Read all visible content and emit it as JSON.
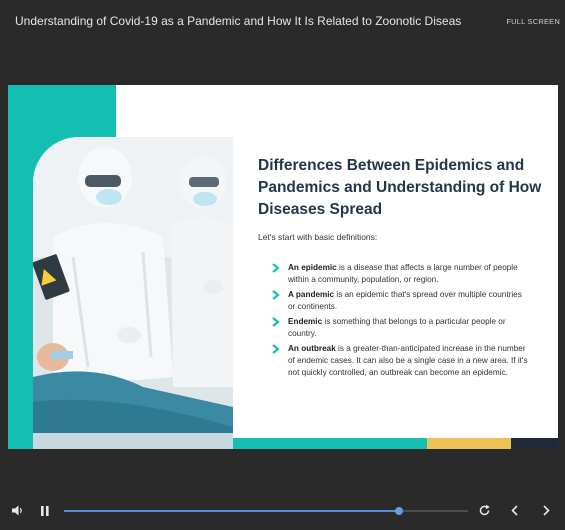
{
  "header": {
    "title": "Understanding of Covid-19 as a Pandemic and How It Is Related to Zoonotic Diseas",
    "fullscreen_label": "FULL SCREEN"
  },
  "slide": {
    "heading": "Differences Between Epidemics and Pandemics and Understanding of How Diseases Spread",
    "intro": "Let's start with basic definitions:",
    "bullets": [
      {
        "term": "An epidemic",
        "text": " is a disease that affects a large number of people within a community, population, or region."
      },
      {
        "term": "A pandemic",
        "text": " is an epidemic that's spread over multiple countries or continents."
      },
      {
        "term": "Endemic",
        "text": " is something that belongs to a particular people or country."
      },
      {
        "term": "An outbreak",
        "text": " is a greater-than-anticipated increase in the number of endemic cases. It can also be a single case in a new area. If it's not quickly controlled, an outbreak can become an epidemic."
      }
    ],
    "colors": {
      "teal": "#12bfb2",
      "yellow": "#ecc257",
      "navy": "#1f2937",
      "heading": "#24364b"
    }
  },
  "player": {
    "progress_percent": 83,
    "icons": [
      "volume-icon",
      "pause-icon",
      "replay-icon",
      "previous-icon",
      "next-icon"
    ]
  }
}
